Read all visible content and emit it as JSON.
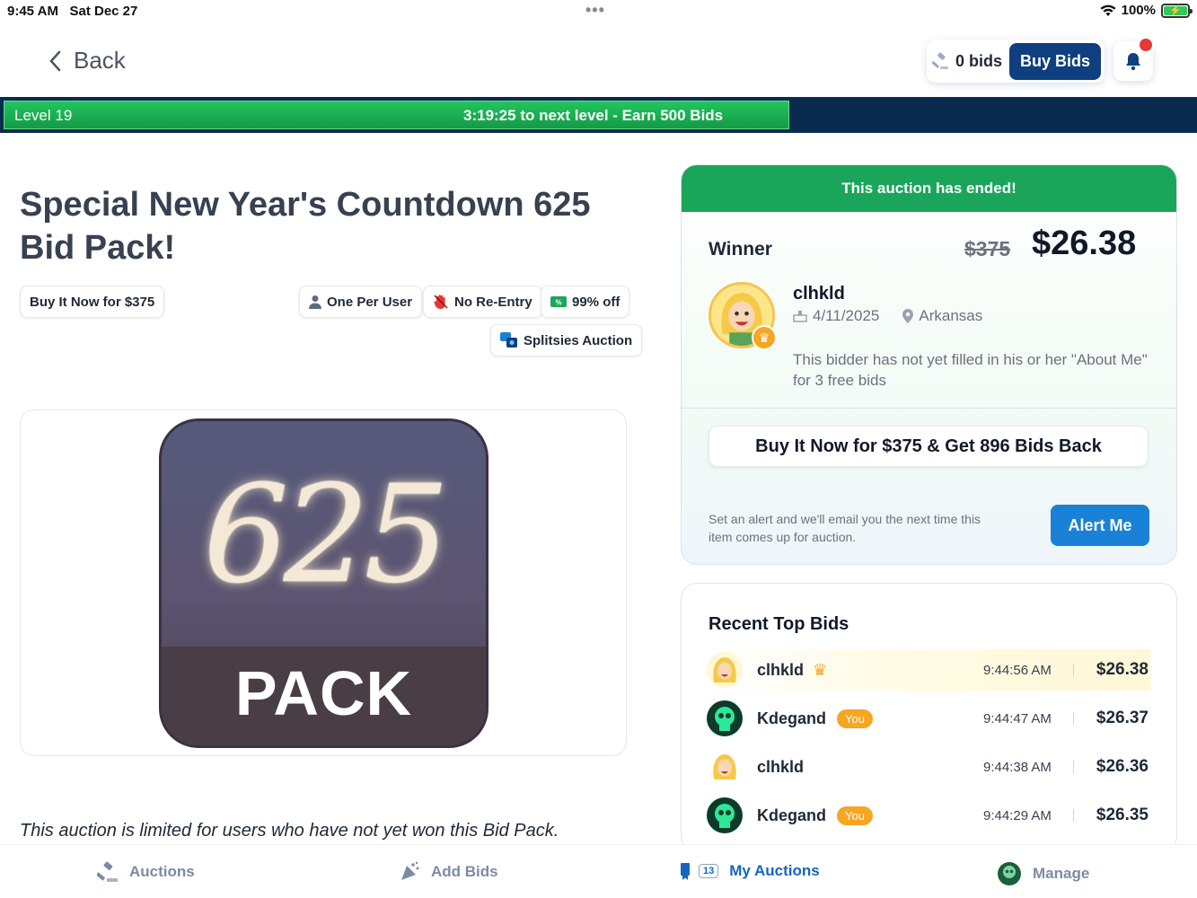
{
  "status_bar": {
    "time": "9:45 AM",
    "date": "Sat Dec 27",
    "battery": "100%"
  },
  "header": {
    "back_label": "Back",
    "bids_count": "0 bids",
    "buy_bids_label": "Buy Bids"
  },
  "level": {
    "label": "Level 19",
    "next": "3:19:25 to next level - Earn 500 Bids",
    "progress": 0.66
  },
  "auction": {
    "title": "Special New Year's Countdown 625 Bid Pack!",
    "buy_now_chip": "Buy It Now for $375",
    "chips": {
      "one_per_user": "One Per User",
      "no_reentry": "No Re-Entry",
      "discount": "99% off",
      "splitsies": "Splitsies Auction"
    },
    "image": {
      "number": "625",
      "word": "PACK"
    },
    "limit_note": "This auction is limited for users who have not yet won this Bid Pack."
  },
  "result": {
    "banner": "This auction has ended!",
    "winner_label": "Winner",
    "retail_price": "$375",
    "final_price": "$26.38",
    "winner_name": "clhkld",
    "win_date": "4/11/2025",
    "location": "Arkansas",
    "about": "This bidder has not yet filled in his or her \"About Me\" for 3 free bids",
    "buy_now_button": "Buy It Now for $375 & Get 896 Bids Back",
    "alert_text": "Set an alert and we'll email you the next time this item comes up for auction.",
    "alert_button": "Alert Me"
  },
  "recent_bids": {
    "title": "Recent Top Bids",
    "rows": [
      {
        "name": "clhkld",
        "time": "9:44:56 AM",
        "amount": "$26.38",
        "you": ""
      },
      {
        "name": "Kdegand",
        "time": "9:44:47 AM",
        "amount": "$26.37",
        "you": "You"
      },
      {
        "name": "clhkld",
        "time": "9:44:38 AM",
        "amount": "$26.36",
        "you": ""
      },
      {
        "name": "Kdegand",
        "time": "9:44:29 AM",
        "amount": "$26.35",
        "you": "You"
      }
    ]
  },
  "nav": {
    "auctions": "Auctions",
    "add_bids": "Add Bids",
    "my_auctions": "My Auctions",
    "my_auctions_badge": "13",
    "manage": "Manage"
  },
  "colors": {
    "brand_navy": "#0f3f7e",
    "level_green": "#1aa55a",
    "accent_blue": "#1a82d6",
    "you_orange": "#f5a623"
  },
  "icons": [
    "chevron-left-icon",
    "gavel-icon",
    "bell-icon",
    "person-icon",
    "hand-stop-icon",
    "ticket-icon",
    "splitsies-icon",
    "crown-icon",
    "calendar-icon",
    "location-pin-icon",
    "add-bids-icon",
    "my-auctions-icon",
    "manage-icon"
  ]
}
